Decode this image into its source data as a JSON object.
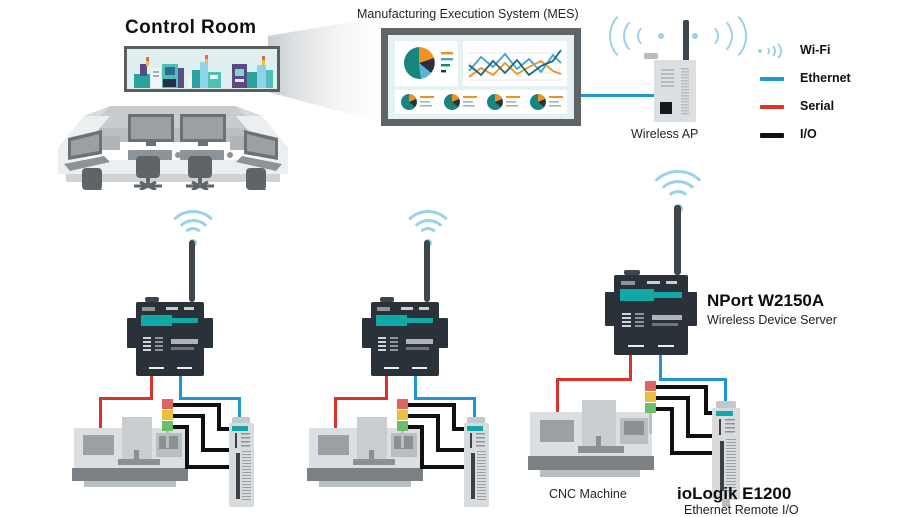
{
  "diagram": {
    "title_control_room": "Control Room",
    "title_mes": "Manufacturing Execution System (MES)",
    "label_wireless_ap": "Wireless AP",
    "label_cnc": "CNC Machine",
    "nport": {
      "name": "NPort W2150A",
      "subtitle": "Wireless Device Server"
    },
    "iologik": {
      "name": "ioLogik E1200",
      "subtitle": "Ethernet Remote I/O"
    }
  },
  "legend": {
    "items": [
      {
        "label": "Wi-Fi",
        "icon": "wifi-icon",
        "color": "#9ad2e8"
      },
      {
        "label": "Ethernet",
        "icon": "line-icon",
        "color": "#2196d6"
      },
      {
        "label": "Serial",
        "icon": "line-icon",
        "color": "#d9342b"
      },
      {
        "label": "I/O",
        "icon": "line-icon",
        "color": "#101010"
      }
    ]
  },
  "colors": {
    "ethernet": "#2196d6",
    "serial": "#d9342b",
    "io": "#101010",
    "wifi": "#9ad2e8",
    "device_dark": "#2a3138",
    "device_accent": "#11a8a8",
    "machine_gray": "#dcdfe1",
    "stack_red": "#e0645f",
    "stack_yellow": "#e8c13c",
    "stack_green": "#6cbf6a"
  },
  "mes_dashboard": {
    "pie_main": {
      "values": [
        44,
        30,
        18,
        8
      ],
      "colors": [
        "#18857e",
        "#f0921e",
        "#59b4dd",
        "#27323c"
      ]
    },
    "line_chart": {
      "series": [
        "#f0921e",
        "#3ea4d6",
        "#1b6b78"
      ]
    },
    "small_pies": 4
  },
  "stations": [
    {
      "id": "station-1",
      "device": "nport",
      "machine": "cnc",
      "io": "iologik"
    },
    {
      "id": "station-2",
      "device": "nport",
      "machine": "cnc",
      "io": "iologik"
    },
    {
      "id": "station-3",
      "device": "nport",
      "machine": "cnc",
      "io": "iologik"
    }
  ]
}
